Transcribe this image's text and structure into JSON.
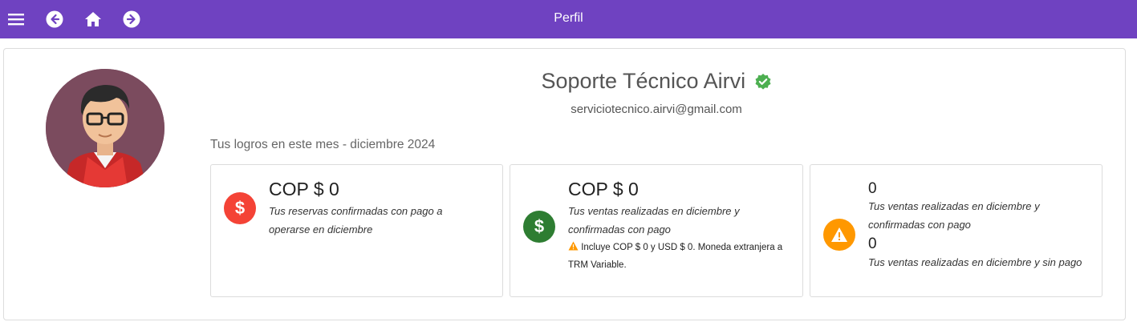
{
  "header": {
    "title": "Perfil",
    "icons": [
      "menu-icon",
      "back-icon",
      "home-icon",
      "forward-icon"
    ]
  },
  "profile": {
    "name": "Soporte Técnico Airvi",
    "email": "serviciotecnico.airvi@gmail.com",
    "verified": true
  },
  "achievements": {
    "heading": "Tus logros en este mes - diciembre 2024",
    "cards": [
      {
        "amount": "COP $ 0",
        "desc": "Tus reservas confirmadas con pago a operarse en diciembre",
        "icon": "dollar-icon",
        "color": "#f44336"
      },
      {
        "amount": "COP $ 0",
        "desc": "Tus ventas realizadas en diciembre y confirmadas con pago",
        "note": "Incluye COP $ 0 y USD $ 0. Moneda extranjera a TRM Variable.",
        "icon": "dollar-icon",
        "color": "#2e7d32"
      },
      {
        "value1": "0",
        "desc1": "Tus ventas realizadas en diciembre y confirmadas con pago",
        "value2": "0",
        "desc2": "Tus ventas realizadas en diciembre y sin pago",
        "icon": "warning-icon",
        "color": "#ff9800"
      }
    ]
  },
  "colors": {
    "primary": "#6f42c1",
    "verified": "#4caf50"
  }
}
